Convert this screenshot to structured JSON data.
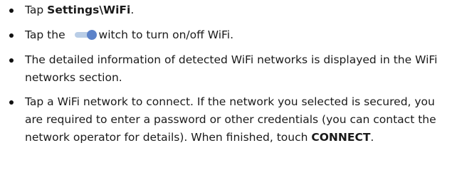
{
  "steps": [
    {
      "prefix": "Tap ",
      "bold": "Settings\\WiFi",
      "suffix": "."
    },
    {
      "prefix": "Tap the ",
      "icon": "toggle-switch-icon",
      "suffix": "witch to turn on/off WiFi."
    },
    {
      "text": "The detailed information of detected WiFi networks is displayed in the WiFi networks section."
    },
    {
      "text": "Tap a WiFi network to connect. If the network you selected is secured, you are required to enter a password or other credentials (you can contact the network operator for details). When finished, touch ",
      "bold": "CONNECT",
      "suffix": "."
    }
  ],
  "colors": {
    "text": "#1a1a1a",
    "switch_track": "#b9cde6",
    "switch_thumb": "#5b82c9"
  }
}
